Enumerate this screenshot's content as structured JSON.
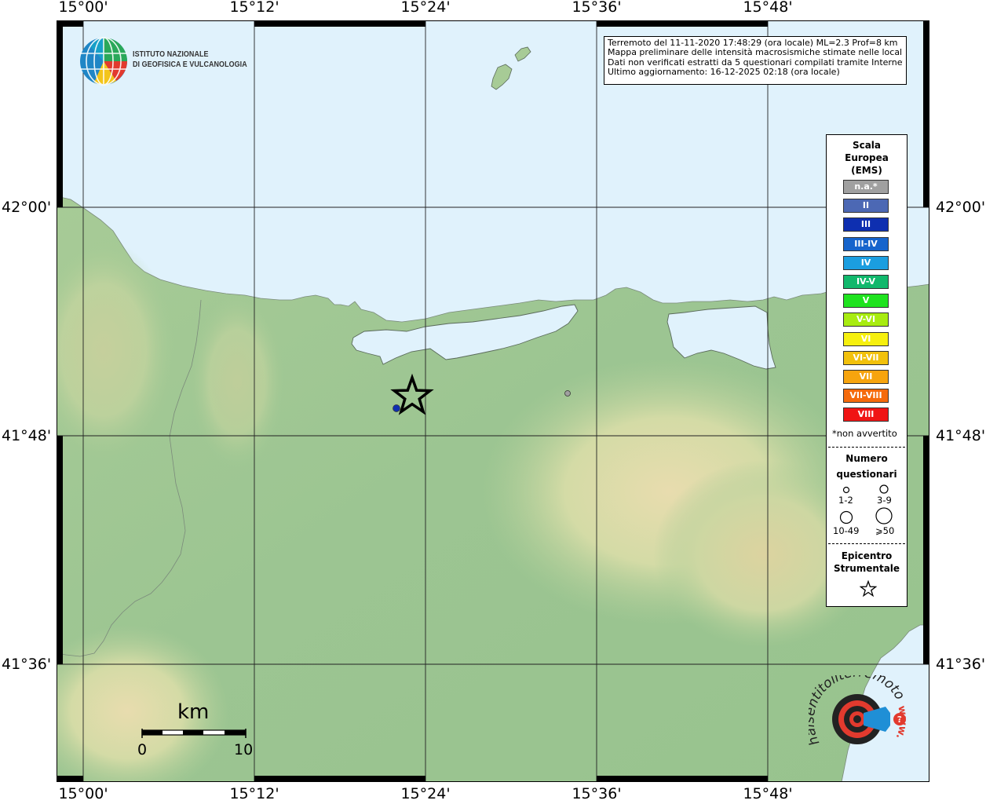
{
  "map": {
    "coords": {
      "lon_labels": [
        "15°00'",
        "15°12'",
        "15°24'",
        "15°36'",
        "15°48'"
      ],
      "lat_labels": [
        "42°00'",
        "41°48'",
        "41°36'"
      ]
    },
    "colors": {
      "sea": "#e0f2fc",
      "land_low": "#a2c994",
      "land_mid": "#c9d8a2",
      "land_high": "#e3d9a6",
      "frame": "#000000"
    }
  },
  "logo": {
    "line1": "ISTITUTO NAZIONALE",
    "line2": "DI GEOFISICA E VULCANOLOGIA",
    "icon": "ingv-globe-icon"
  },
  "info": {
    "line1": "Terremoto del 11-11-2020 17:48:29 (ora locale) ML=2.3 Prof=8 km",
    "line2": "Mappa preliminare delle intensità macrosismiche stimate nelle località",
    "line3": "Dati non verificati estratti da 5 questionari compilati tramite Internet.",
    "line4": "Ultimo aggiornamento: 16-12-2025 02:18 (ora locale)"
  },
  "legend": {
    "title_line1": "Scala",
    "title_line2": "Europea",
    "title_line3": "(EMS)",
    "scale": [
      {
        "label": "n.a.*",
        "color": "#a0a0a0"
      },
      {
        "label": "II",
        "color": "#4c68b4"
      },
      {
        "label": "III",
        "color": "#0e2fb0"
      },
      {
        "label": "III-IV",
        "color": "#1664cc"
      },
      {
        "label": "IV",
        "color": "#1b9ee0"
      },
      {
        "label": "IV-V",
        "color": "#11b86c"
      },
      {
        "label": "V",
        "color": "#1fe31f"
      },
      {
        "label": "V-VI",
        "color": "#a8ec10"
      },
      {
        "label": "VI",
        "color": "#f6f00e"
      },
      {
        "label": "VI-VII",
        "color": "#f2c10c"
      },
      {
        "label": "VII",
        "color": "#f7a40e"
      },
      {
        "label": "VII-VIII",
        "color": "#f56a0c"
      },
      {
        "label": "VIII",
        "color": "#f01414"
      }
    ],
    "not_felt": "*non avvertito",
    "count_title_line1": "Numero",
    "count_title_line2": "questionari",
    "count_classes": [
      "1-2",
      "3-9",
      "10-49",
      "⩾50"
    ],
    "epicenter_line1": "Epicentro",
    "epicenter_line2": "Strumentale",
    "epicenter_icon": "star-icon"
  },
  "scalebar": {
    "unit": "km",
    "min_label": "0",
    "max_label": "10"
  },
  "markers": {
    "epicenter": {
      "lon": "15°22'",
      "lat": "41°50'"
    },
    "reports": [
      {
        "intensity": "III",
        "color": "#0e2fb0"
      },
      {
        "intensity": "n.a.*",
        "color": "#a0a0a0"
      }
    ]
  },
  "haisentito": {
    "text": "haisentitoilterremoto.it",
    "url_prefix": "www."
  }
}
